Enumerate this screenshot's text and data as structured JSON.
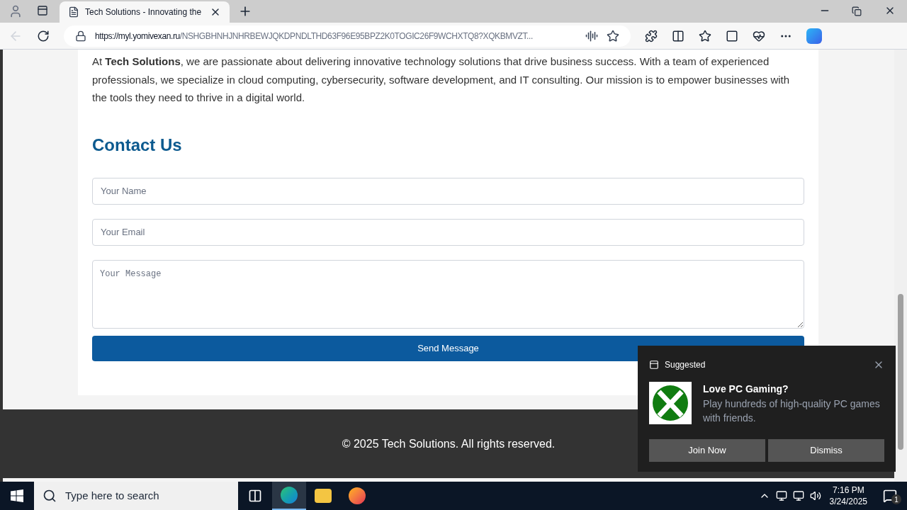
{
  "browser": {
    "tab_title": "Tech Solutions - Innovating the",
    "url_host": "https://myl.yomivexan.ru",
    "url_path": "/NSHGBHNHJNHRBEWJQKDPNDLTHD63F96E95BPZ2K0TOGIC26F9WCHXTQ8?XQKBMVZT..."
  },
  "page": {
    "intro": "At **Tech Solutions**, we are passionate about delivering innovative technology solutions that drive business success. With a team of experienced professionals, we specialize in cloud computing, cybersecurity, software development, and IT consulting. Our mission is to empower businesses with the tools they need to thrive in a digital world.",
    "contact_heading": "Contact Us",
    "fields": [
      {
        "kind": "input",
        "placeholder": "Your Name"
      },
      {
        "kind": "input",
        "placeholder": "Your Email"
      },
      {
        "kind": "textarea",
        "placeholder": "Your Message"
      }
    ],
    "submit": "Send Message",
    "footer": "© 2025 Tech Solutions. All rights reserved."
  },
  "notification": {
    "header": "Suggested",
    "title": "Love PC Gaming?",
    "body": "Play hundreds of high-quality PC games with friends.",
    "buttons": [
      "Join Now",
      "Dismiss"
    ]
  },
  "taskbar": {
    "search_placeholder": "Type here to search",
    "time": "7:16 PM",
    "date": "3/24/2025",
    "notification_count": "1"
  }
}
